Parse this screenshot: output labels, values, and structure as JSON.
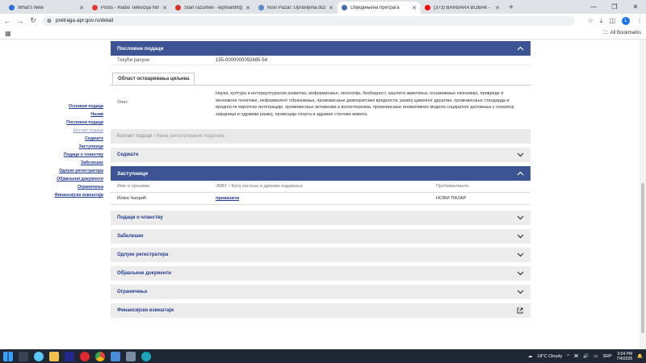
{
  "browser": {
    "tabs": [
      {
        "title": "What's New",
        "color": "#2c6fd6",
        "active": false
      },
      {
        "title": "Posts - Radio Televizija Novi Pa",
        "color": "#e23a3a",
        "active": false
      },
      {
        "title": "Stari razumeli - wpmail99@gm",
        "color": "#d93025",
        "active": false
      },
      {
        "title": "Novi Pazar: Upravljena dozvolj",
        "color": "#5a88c9",
        "active": false
      },
      {
        "title": "Обједињена претрага",
        "color": "#4a6aa8",
        "active": true
      },
      {
        "title": "(373) BARBARA BOBAK - ",
        "color": "#ff0000",
        "active": false
      }
    ],
    "url": "pretraga.apr.gov.rs/detail",
    "all_bookmarks": "All Bookmarks",
    "avatar_letter": "L"
  },
  "left_nav": [
    {
      "label": "Основни подаци",
      "dim": false
    },
    {
      "label": "Назив",
      "dim": false
    },
    {
      "label": "Пословни подаци",
      "dim": false
    },
    {
      "label": "Контакт подаци",
      "dim": true
    },
    {
      "label": "Седиште",
      "dim": false
    },
    {
      "label": "Заступници",
      "dim": false
    },
    {
      "label": "Подаци о чланству",
      "dim": false
    },
    {
      "label": "Забелешке",
      "dim": false
    },
    {
      "label": "Одлуке регистратора",
      "dim": false
    },
    {
      "label": "Објављени документи",
      "dim": false
    },
    {
      "label": "Ограничења",
      "dim": false
    },
    {
      "label": "Финансијски извештаји",
      "dim": false
    }
  ],
  "poslovni": {
    "title": "Пословни подаци",
    "account_label": "Текући рачуни",
    "account_value": "155-0000000092685-54",
    "subtab": "Област остваривања циљева",
    "desc_label": "Опис",
    "desc_value": "Наука, култура и интеркултурални развитак, информисање, екологија, безбедност, заштита животиња, оснаживање економије, привреде и економске политике, неформалног образовања, промовисање демократских вредности, развој цивилног друштва, промовисање стандарда и вредности европске интеграције, промовисање активизма и волонтеризма, промовисање иновативних модела социјалног деловања у локалној заједници и одрживи развој, промоција спорта и здравих стилова живота."
  },
  "crumb": {
    "part1": "Контакт подаци",
    "sep": "/",
    "part2": "Нема регистрованих података"
  },
  "sediste": {
    "title": "Седиште"
  },
  "zastupnici": {
    "title": "Заступници",
    "columns": [
      "Име и презиме",
      "ЈМБГ / Број пасоша и држава издавања",
      "Пребивалиште"
    ],
    "rows": [
      {
        "name": "Илма Чапрић",
        "id": "приказати",
        "residence": "НОВИ ПАЗАР"
      }
    ]
  },
  "accordions": [
    {
      "title": "Подаци о чланству",
      "icon": "chevron-down-icon"
    },
    {
      "title": "Забелешке",
      "icon": "chevron-down-icon"
    },
    {
      "title": "Одлуке регистратора",
      "icon": "chevron-down-icon"
    },
    {
      "title": "Објављени документи",
      "icon": "chevron-down-icon"
    },
    {
      "title": "Ограничења",
      "icon": "chevron-down-icon"
    },
    {
      "title": "Финансијски извештаји",
      "icon": "external-link-icon"
    }
  ],
  "taskbar": {
    "weather": "18°C  Cloudy",
    "lang": "SRP",
    "time": "3:04 PM",
    "date": "7/4/2025"
  },
  "colors": {
    "section_header": "#3c5494",
    "link": "#243b8f",
    "accordion_bg": "#ececec"
  }
}
